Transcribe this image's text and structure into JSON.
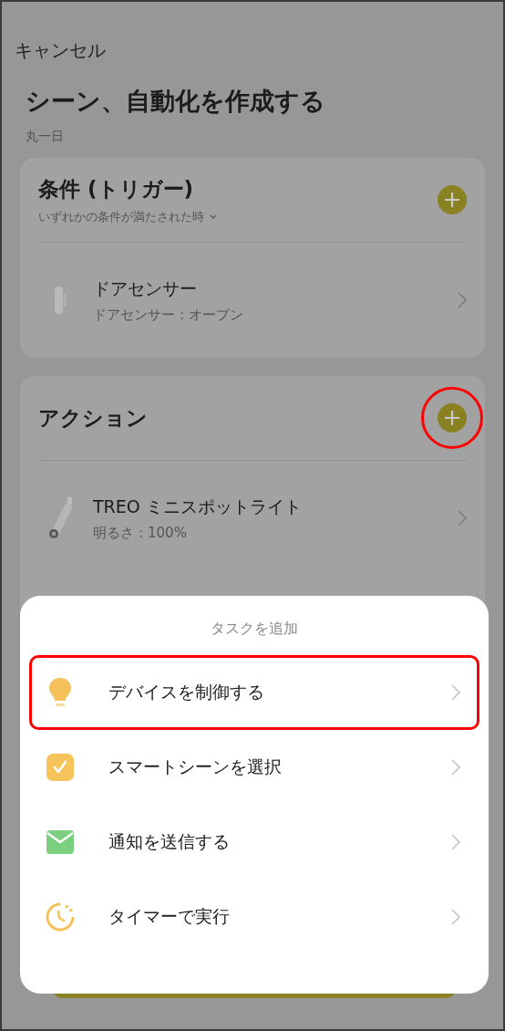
{
  "header": {
    "cancel": "キャンセル",
    "title": "シーン、自動化を作成する",
    "subtitle": "丸一日"
  },
  "conditions": {
    "title": "条件 (トリガー)",
    "mode": "いずれかの条件が満たされた時",
    "add_highlighted": false,
    "items": [
      {
        "kind": "door-sensor",
        "name": "ドアセンサー",
        "detail": "ドアセンサー：オープン"
      }
    ]
  },
  "actions": {
    "title": "アクション",
    "add_highlighted": true,
    "items": [
      {
        "kind": "spotlight",
        "name": "TREO ミニスポットライト",
        "detail": "明るさ：100%"
      }
    ]
  },
  "sheet": {
    "title": "タスクを追加",
    "items": [
      {
        "kind": "device",
        "label": "デバイスを制御する",
        "highlighted": true
      },
      {
        "kind": "scene",
        "label": "スマートシーンを選択",
        "highlighted": false
      },
      {
        "kind": "notify",
        "label": "通知を送信する",
        "highlighted": false
      },
      {
        "kind": "timer",
        "label": "タイマーで実行",
        "highlighted": false
      }
    ]
  }
}
